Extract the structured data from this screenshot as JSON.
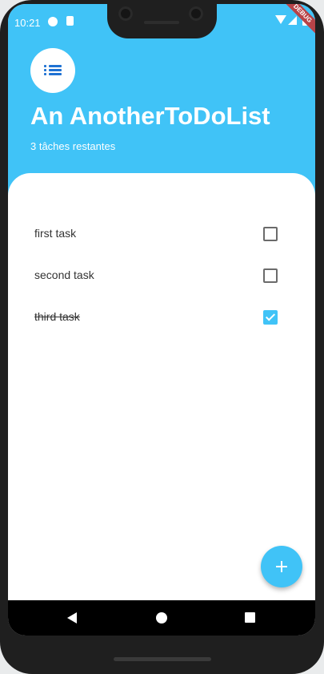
{
  "status_bar": {
    "time": "10:21",
    "debug_label": "DEBUG"
  },
  "header": {
    "app_icon": "list-icon",
    "title": "An AnotherToDoList",
    "subtitle": "3 tâches restantes"
  },
  "tasks": [
    {
      "label": "first task",
      "checked": false
    },
    {
      "label": "second task",
      "checked": false
    },
    {
      "label": "third task",
      "checked": true
    }
  ],
  "fab": {
    "icon": "plus-icon"
  },
  "nav_bar": {
    "back_icon": "back-icon",
    "home_icon": "home-icon",
    "recents_icon": "recents-icon"
  },
  "colors": {
    "accent": "#40c3f7",
    "icon_blue": "#1f72d3",
    "debug_ribbon": "#b84348"
  }
}
